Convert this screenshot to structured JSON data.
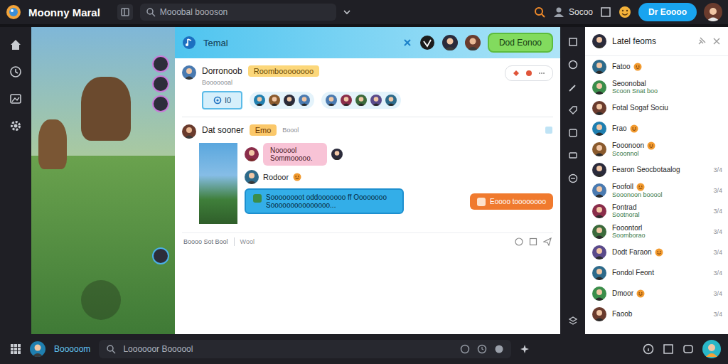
{
  "window": {
    "title": "Moonny Maral"
  },
  "top_search": {
    "placeholder": "Mooobal boooson"
  },
  "top_user": {
    "label": "Socoo"
  },
  "top_button": "Dr Eoooo",
  "chat": {
    "title": "Temal",
    "action": "Dod Eonoo",
    "first": {
      "author": "Dorronoob",
      "tag": "Roomboooooooo",
      "sub": "Booooooal",
      "counter": "I0"
    },
    "second": {
      "author": "Dat sooner",
      "tag": "Emo",
      "sub": "Boool"
    },
    "pink": {
      "title": "Noooool",
      "text": "Sommooooo."
    },
    "reply": {
      "author": "Rodoor",
      "emoji": true
    },
    "blue": "Soooooooot oddooooooo ff Oooooooo Sooooooooooooooo...",
    "orange": "Eoooo toooooooo",
    "composer": {
      "label": "Boooo Sot Bool",
      "placeholder": "Wool"
    }
  },
  "friends": {
    "title": "Latel feoms",
    "items": [
      {
        "name": "Fatoo",
        "sub": "",
        "emoji": true,
        "time": ""
      },
      {
        "name": "Seoonobal",
        "sub": "Scoon Snat boo",
        "emoji": false,
        "time": ""
      },
      {
        "name": "Fotal Sogaf Sociu",
        "sub": "",
        "emoji": false,
        "time": ""
      },
      {
        "name": "Frao",
        "sub": "",
        "emoji": true,
        "time": ""
      },
      {
        "name": "Fooonoon",
        "sub": "Scoonnol",
        "emoji": true,
        "time": ""
      },
      {
        "name": "Fearon Seocbotaalog",
        "sub": "",
        "emoji": false,
        "time": "3/4"
      },
      {
        "name": "Foofoll",
        "sub": "Sooonoon booool",
        "emoji": true,
        "time": "3/4"
      },
      {
        "name": "Fontrad",
        "sub": "Sootnoral",
        "emoji": false,
        "time": "3/4"
      },
      {
        "name": "Fooontorl",
        "sub": "Soomborao",
        "emoji": false,
        "time": "3/4"
      },
      {
        "name": "Dodt Faraon",
        "sub": "",
        "emoji": true,
        "time": "3/4"
      },
      {
        "name": "Fondol Feont",
        "sub": "",
        "emoji": false,
        "time": "3/4"
      },
      {
        "name": "Dmoor",
        "sub": "",
        "emoji": true,
        "time": "3/4"
      },
      {
        "name": "Faoob",
        "sub": "",
        "emoji": false,
        "time": "3/4"
      }
    ]
  },
  "bottom": {
    "label": "Booooom",
    "search": "Loooooor Boooool"
  }
}
